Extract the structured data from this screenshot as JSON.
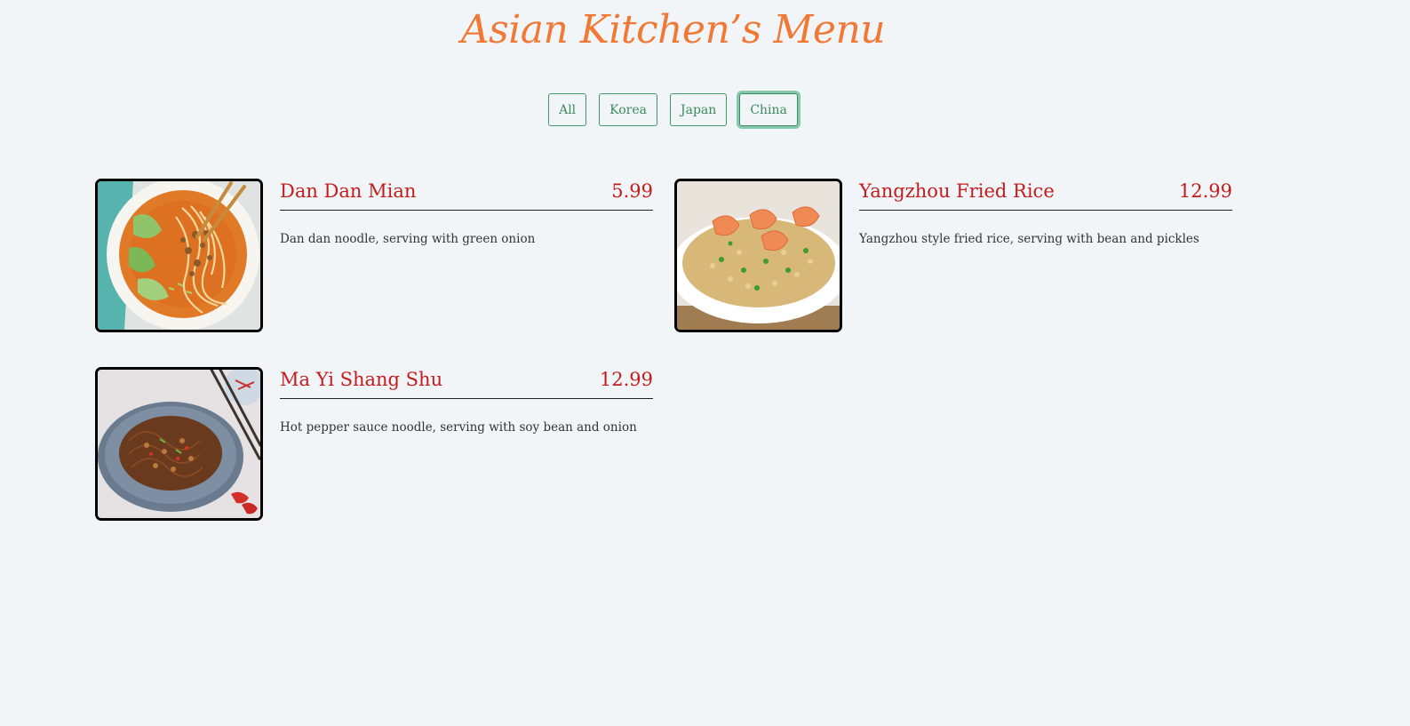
{
  "header": {
    "title": "Asian Kitchen’s Menu"
  },
  "filters": [
    {
      "label": "All",
      "active": false
    },
    {
      "label": "Korea",
      "active": false
    },
    {
      "label": "Japan",
      "active": false
    },
    {
      "label": "China",
      "active": true
    }
  ],
  "menu": {
    "items": [
      {
        "name": "Dan Dan Mian",
        "price": "5.99",
        "description": "Dan dan noodle, serving with green onion",
        "image_icon": "noodle-bowl-photo"
      },
      {
        "name": "Yangzhou Fried Rice",
        "price": "12.99",
        "description": "Yangzhou style fried rice, serving with bean and pickles",
        "image_icon": "fried-rice-photo"
      },
      {
        "name": "Ma Yi Shang Shu",
        "price": "12.99",
        "description": "Hot pepper sauce noodle, serving with soy bean and onion",
        "image_icon": "glass-noodle-photo"
      }
    ]
  },
  "colors": {
    "background": "#f1f5f8",
    "title": "#f07a35",
    "filter_accent": "#3a8a5f",
    "item_text": "#c41c1c"
  }
}
